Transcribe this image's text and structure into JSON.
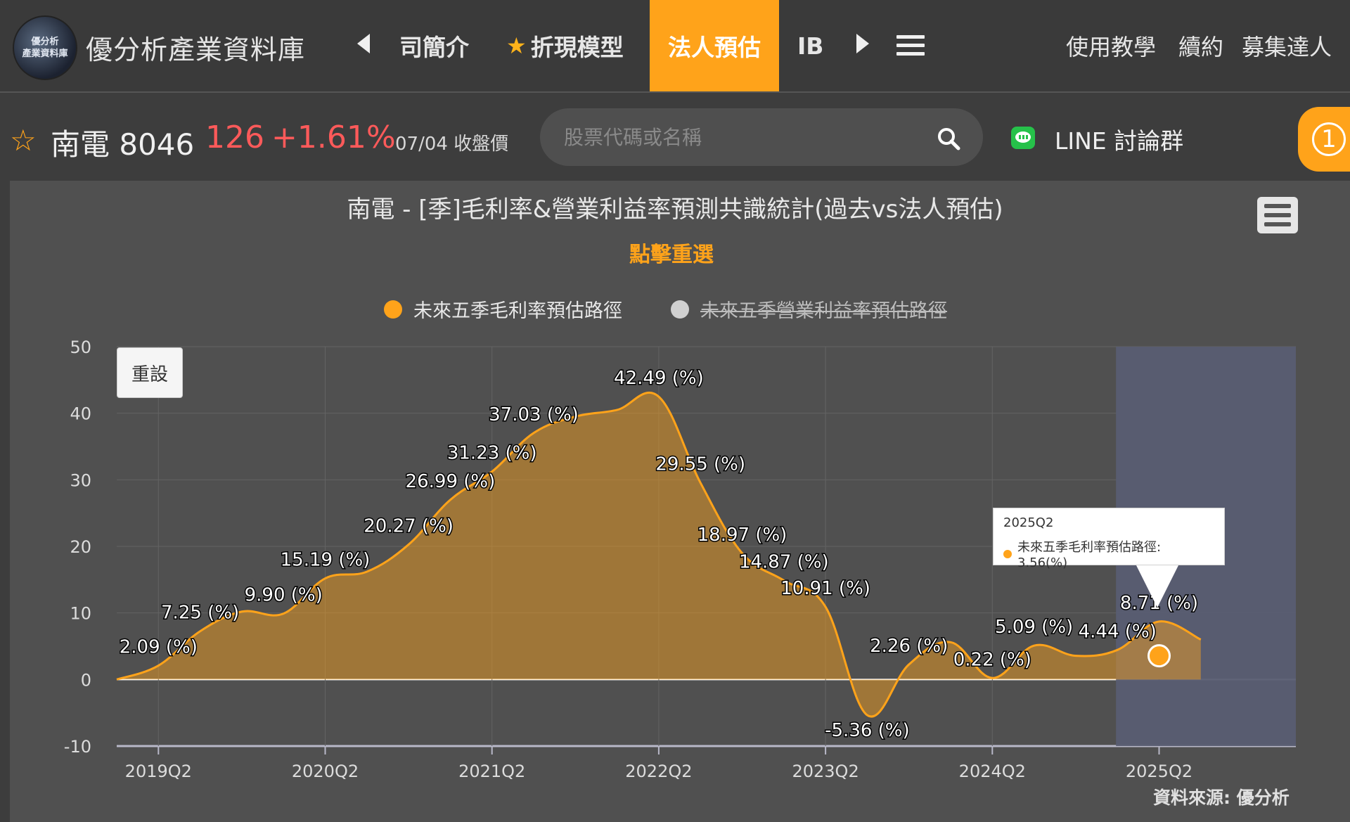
{
  "header": {
    "logo_text_line1": "優分析",
    "logo_text_line2": "產業資料庫",
    "site_title": "優分析產業資料庫",
    "nav_items": [
      "司簡介",
      "折現模型",
      "法人預估",
      "IBI"
    ],
    "nav_right": [
      "使用教學",
      "續約",
      "募集達人"
    ]
  },
  "stock": {
    "name": "南電 8046",
    "price": "126",
    "change": "+1.61%",
    "date_label": "07/04 收盤價"
  },
  "search": {
    "placeholder": "股票代碼或名稱"
  },
  "line_group": {
    "label": "LINE 討論群"
  },
  "notification": {
    "count": "1"
  },
  "chart_ui": {
    "reset_label": "重設",
    "source": "資料來源: 優分析",
    "tooltip_title": "2025Q2",
    "tooltip_text": "未來五季毛利率預估路徑: 3.56(%)"
  },
  "colors": {
    "accent": "#ffa31a",
    "price_up": "#ff5a5a",
    "area_fill": "#8a6e3c",
    "forecast_band": "#585d72",
    "line_green": "#26c14a"
  },
  "chart_data": {
    "type": "area",
    "title": "南電 - [季]毛利率&營業利益率預測共識統計(過去vs法人預估)",
    "subtitle": "點擊重選",
    "legend": [
      {
        "name": "未來五季毛利率預估路徑",
        "color": "#ffa31a",
        "active": true
      },
      {
        "name": "未來五季營業利益率預估路徑",
        "color": "#d0d0d0",
        "active": false
      }
    ],
    "y_ticks": [
      50,
      40,
      30,
      20,
      10,
      0,
      -10
    ],
    "ylim": [
      -10,
      50
    ],
    "x_ticks": [
      "2019Q2",
      "2020Q2",
      "2021Q2",
      "2022Q2",
      "2023Q2",
      "2024Q2",
      "2025Q2"
    ],
    "forecast_start": "2025Q1",
    "highlight": {
      "x": "2025Q2",
      "value": 3.56
    },
    "series": [
      {
        "name": "未來五季毛利率預估路徑",
        "points": [
          {
            "x": "2019Q1",
            "value": 0.0
          },
          {
            "x": "2019Q2",
            "value": 2.09,
            "label": "2.09 (%)"
          },
          {
            "x": "2019Q3",
            "value": 7.25,
            "label": "7.25 (%)"
          },
          {
            "x": "2019Q4",
            "value": 10.2
          },
          {
            "x": "2020Q1",
            "value": 9.9,
            "label": "9.90 (%)"
          },
          {
            "x": "2020Q2",
            "value": 15.19,
            "label": "15.19 (%)"
          },
          {
            "x": "2020Q3",
            "value": 16.2
          },
          {
            "x": "2020Q4",
            "value": 20.27,
            "label": "20.27 (%)"
          },
          {
            "x": "2021Q1",
            "value": 26.99,
            "label": "26.99 (%)"
          },
          {
            "x": "2021Q2",
            "value": 31.23,
            "label": "31.23 (%)"
          },
          {
            "x": "2021Q3",
            "value": 37.03,
            "label": "37.03 (%)"
          },
          {
            "x": "2021Q4",
            "value": 39.5
          },
          {
            "x": "2022Q1",
            "value": 40.5
          },
          {
            "x": "2022Q2",
            "value": 42.49,
            "label": "42.49 (%)"
          },
          {
            "x": "2022Q3",
            "value": 29.55,
            "label": "29.55 (%)"
          },
          {
            "x": "2022Q4",
            "value": 18.97,
            "label": "18.97 (%)"
          },
          {
            "x": "2023Q1",
            "value": 14.87,
            "label": "14.87 (%)"
          },
          {
            "x": "2023Q2",
            "value": 10.91,
            "label": "10.91 (%)"
          },
          {
            "x": "2023Q3",
            "value": -5.36,
            "label": "-5.36 (%)"
          },
          {
            "x": "2023Q4",
            "value": 2.26,
            "label": "2.26 (%)"
          },
          {
            "x": "2024Q1",
            "value": 5.6
          },
          {
            "x": "2024Q2",
            "value": 0.22,
            "label": "0.22 (%)"
          },
          {
            "x": "2024Q3",
            "value": 5.09,
            "label": "5.09 (%)"
          },
          {
            "x": "2024Q4",
            "value": 3.56
          },
          {
            "x": "2025Q1",
            "value": 4.44,
            "label": "4.44 (%)"
          },
          {
            "x": "2025Q2",
            "value": 8.71,
            "label": "8.71 (%)"
          },
          {
            "x": "2025Q3",
            "value": 6.0
          }
        ]
      }
    ]
  }
}
